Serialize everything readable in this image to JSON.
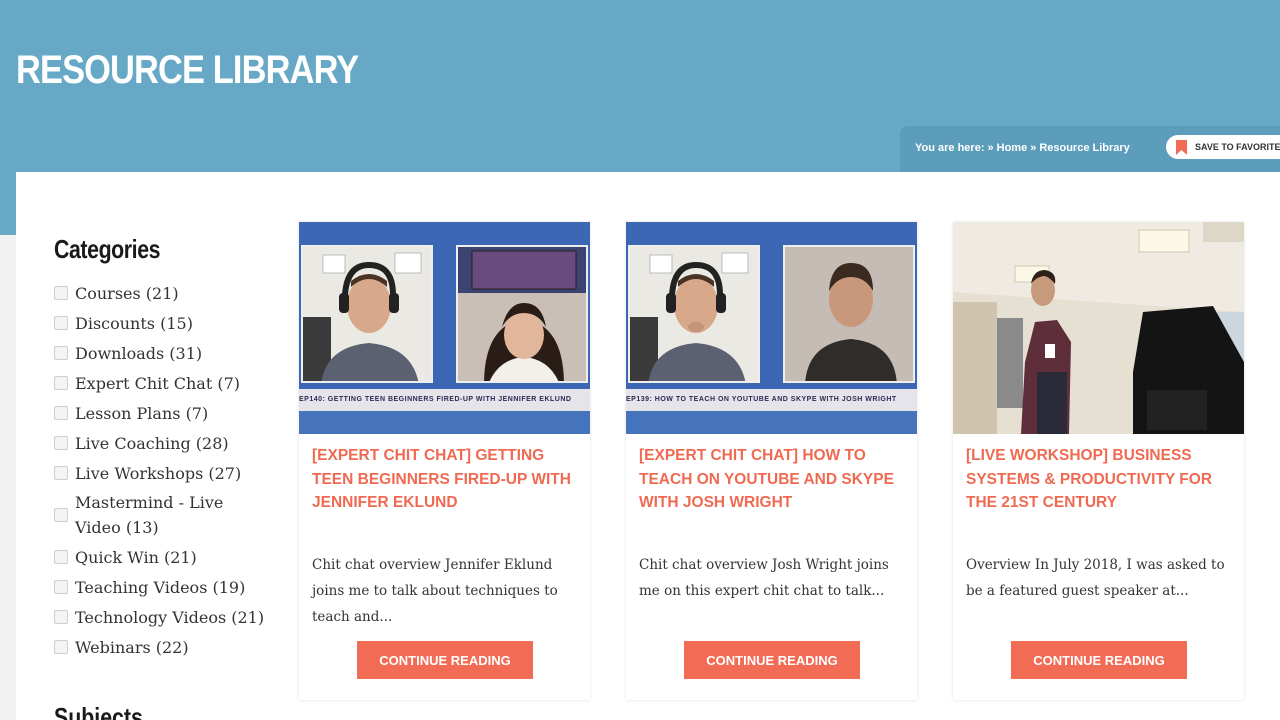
{
  "page": {
    "title": "RESOURCE LIBRARY"
  },
  "breadcrumb": {
    "prefix": "You are here:",
    "separator": "»",
    "home": "Home",
    "current": "Resource Library"
  },
  "favorites_button": {
    "label": "SAVE TO FAVORITES",
    "icon": "bookmark-icon"
  },
  "sidebar": {
    "categories_heading": "Categories",
    "categories": [
      {
        "label": "Courses (21)"
      },
      {
        "label": "Discounts (15)"
      },
      {
        "label": "Downloads (31)"
      },
      {
        "label": "Expert Chit Chat (7)"
      },
      {
        "label": "Lesson Plans (7)"
      },
      {
        "label": "Live Coaching (28)"
      },
      {
        "label": "Live Workshops (27)"
      },
      {
        "label": "Mastermind - Live Video (13)"
      },
      {
        "label": "Quick Win (21)"
      },
      {
        "label": "Teaching Videos (19)"
      },
      {
        "label": "Technology Videos (21)"
      },
      {
        "label": "Webinars (22)"
      }
    ],
    "subjects_heading": "Subjects"
  },
  "cards": [
    {
      "title": "[EXPERT CHIT CHAT] GETTING TEEN BEGINNERS FIRED-UP WITH JENNIFER EKLUND",
      "thumb_caption": "EP140: GETTING TEEN BEGINNERS FIRED-UP WITH JENNIFER EKLUND",
      "excerpt": "Chit chat overview Jennifer Eklund joins me to talk about techniques to teach and...",
      "button": "CONTINUE READING"
    },
    {
      "title": "[EXPERT CHIT CHAT] HOW TO TEACH ON YOUTUBE AND SKYPE WITH JOSH WRIGHT",
      "thumb_caption": "EP139: HOW TO TEACH ON YOUTUBE AND SKYPE WITH JOSH WRIGHT",
      "excerpt": "Chit chat overview Josh Wright joins me on this expert chit chat to talk...",
      "button": "CONTINUE READING"
    },
    {
      "title": "[LIVE WORKSHOP] BUSINESS SYSTEMS & PRODUCTIVITY FOR THE 21ST CENTURY",
      "excerpt": "Overview In July 2018, I was asked to be a featured guest speaker at...",
      "button": "CONTINUE READING"
    }
  ],
  "colors": {
    "header": "#66a8c6",
    "accent": "#f26b55",
    "title": "#f06a52",
    "video_bg": "#3c67b4"
  }
}
